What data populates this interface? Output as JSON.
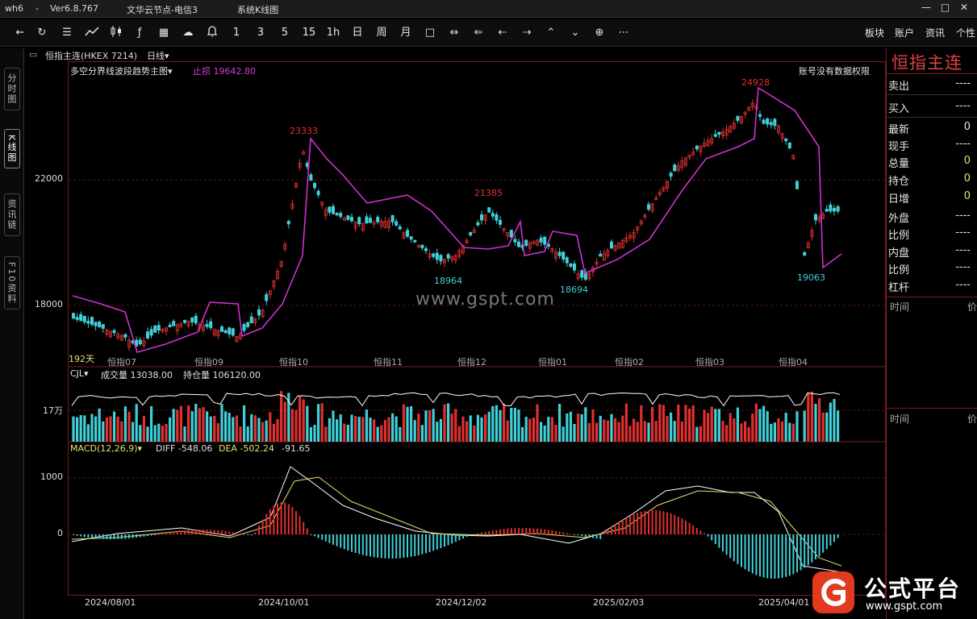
{
  "window": {
    "app": "wh6",
    "dash": "-",
    "version": "Ver6.8.767",
    "server": "文华云节点-电信3",
    "view": "系统K线图",
    "controls": [
      "—",
      "□",
      "✕"
    ]
  },
  "toolbar": {
    "periods": [
      "1",
      "3",
      "5",
      "15",
      "1h",
      "日",
      "周",
      "月"
    ],
    "right": [
      "板块",
      "账户",
      "资讯",
      "个性"
    ]
  },
  "side_tabs": [
    "分时图",
    "K线图",
    "资讯链",
    "F10资料"
  ],
  "instrument": {
    "name": "恒指主连(HKEX 7214)",
    "period": "日线▾",
    "indicator": "多空分界线波段趋势主图▾",
    "stoploss": "止损 19642.80",
    "permission": "账号没有数据权限",
    "days": "192天"
  },
  "price_labels": {
    "p1": "23333",
    "p2": "21385",
    "p3": "24928",
    "p4": "18964",
    "p5": "18694",
    "p6": "19063"
  },
  "y_labels": {
    "y22000": "22000",
    "y18000": "18000",
    "vol": "17万",
    "m1000": "1000",
    "m0": "0"
  },
  "month_labels": [
    "恒指07",
    "恒指09",
    "恒指10",
    "恒指11",
    "恒指12",
    "恒指01",
    "恒指02",
    "恒指03",
    "恒指04"
  ],
  "volume": {
    "name": "CJL▾",
    "vol": "成交量 13038.00",
    "oi": "持仓量 106120.00"
  },
  "macd": {
    "name": "MACD(12,26,9)▾",
    "diff": "DIFF -548.06",
    "dea": "DEA -502.24",
    "macd": "-91.65"
  },
  "dates": [
    "2024/08/01",
    "2024/10/01",
    "2024/12/02",
    "2025/02/03",
    "2025/04/01"
  ],
  "watermark": "www.gspt.com",
  "quote": {
    "title": "恒指主连",
    "rows": [
      {
        "k": "卖出",
        "v": "----"
      },
      {
        "k": "买入",
        "v": "----"
      },
      {
        "k": "最新",
        "v": "0"
      },
      {
        "k": "现手",
        "v": "----"
      },
      {
        "k": "总量",
        "v": "0"
      },
      {
        "k": "持仓",
        "v": "0"
      },
      {
        "k": "日增",
        "v": "0"
      },
      {
        "k": "外盘",
        "v": "----"
      },
      {
        "k": "比例",
        "v": "----"
      },
      {
        "k": "内盘",
        "v": "----"
      },
      {
        "k": "比例",
        "v": "----"
      },
      {
        "k": "杠杆",
        "v": "----"
      }
    ],
    "time1": "时间",
    "price1": "价",
    "time2": "时间",
    "price2": "价"
  },
  "logo": {
    "text": "公式平台",
    "url": "www.gspt.com"
  },
  "colors": {
    "up": "#e03030",
    "down": "#40d0d8",
    "trend": "#d030d0",
    "diff": "#ffffff",
    "dea": "#e8e070",
    "frame": "#7a1c1c"
  }
}
